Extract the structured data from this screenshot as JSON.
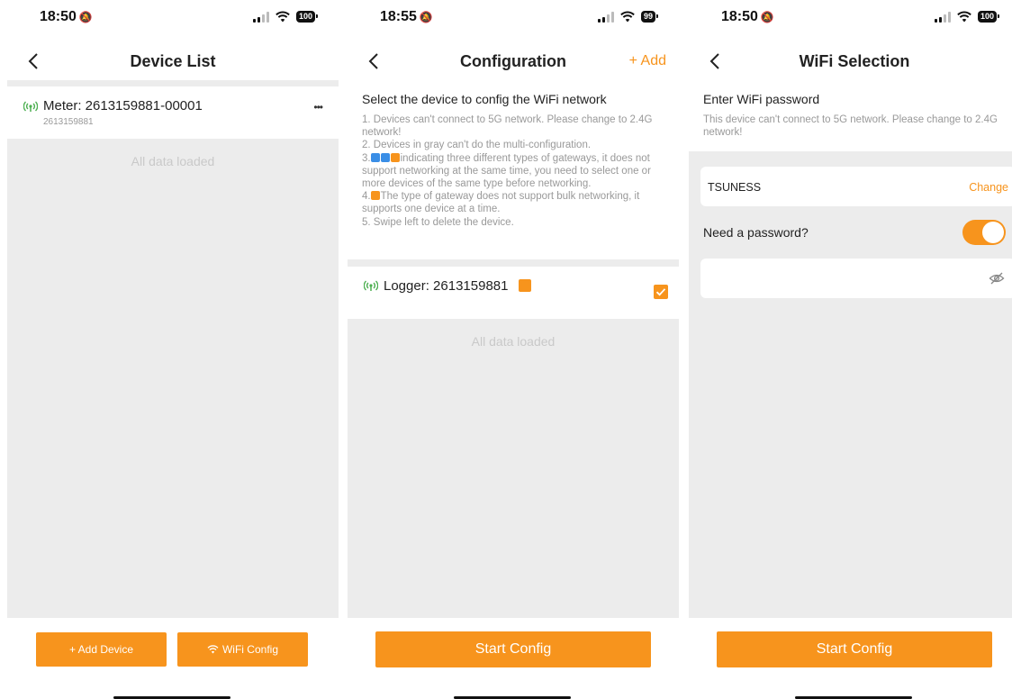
{
  "screens": [
    {
      "status": {
        "time": "18:50",
        "battery": "100"
      },
      "title": "Device List",
      "device": {
        "name": "Meter: 2613159881-00001",
        "sub": "2613159881"
      },
      "more": "•••",
      "footer_text": "All data loaded",
      "buttons": {
        "add_device": "+ Add Device",
        "wifi_config": "WiFi Config"
      }
    },
    {
      "status": {
        "time": "18:55",
        "battery": "99"
      },
      "title": "Configuration",
      "add_label": "+ Add",
      "instruction_title": "Select the device to config the WiFi network",
      "instructions": {
        "l1": "1. Devices can't connect to 5G network. Please change to 2.4G network!",
        "l2": "2. Devices in gray can't do the multi-configuration.",
        "l3_prefix": "3.",
        "l3": "indicating three different types of gateways, it does not support networking at the same time, you need to select one or more devices of the same type before networking.",
        "l4_prefix": "4.",
        "l4": "The type of gateway does not support bulk networking, it supports one device at a time.",
        "l5": "5. Swipe left to delete the device."
      },
      "device": {
        "name": "Logger: 2613159881"
      },
      "footer_text": "All data loaded",
      "button": "Start Config"
    },
    {
      "status": {
        "time": "18:50",
        "battery": "100"
      },
      "title": "WiFi Selection",
      "enter_title": "Enter WiFi password",
      "note": "This device can't connect to 5G network. Please change to 2.4G network!",
      "ssid": "TSUNESS",
      "change_label": "Change",
      "need_password": "Need a password?",
      "password_value": "",
      "button": "Start Config"
    }
  ],
  "colors": {
    "accent": "#f7941d",
    "antenna_green": "#4caf50",
    "gateway_blue": "#3a8ee6",
    "page_gray": "#ececec"
  }
}
